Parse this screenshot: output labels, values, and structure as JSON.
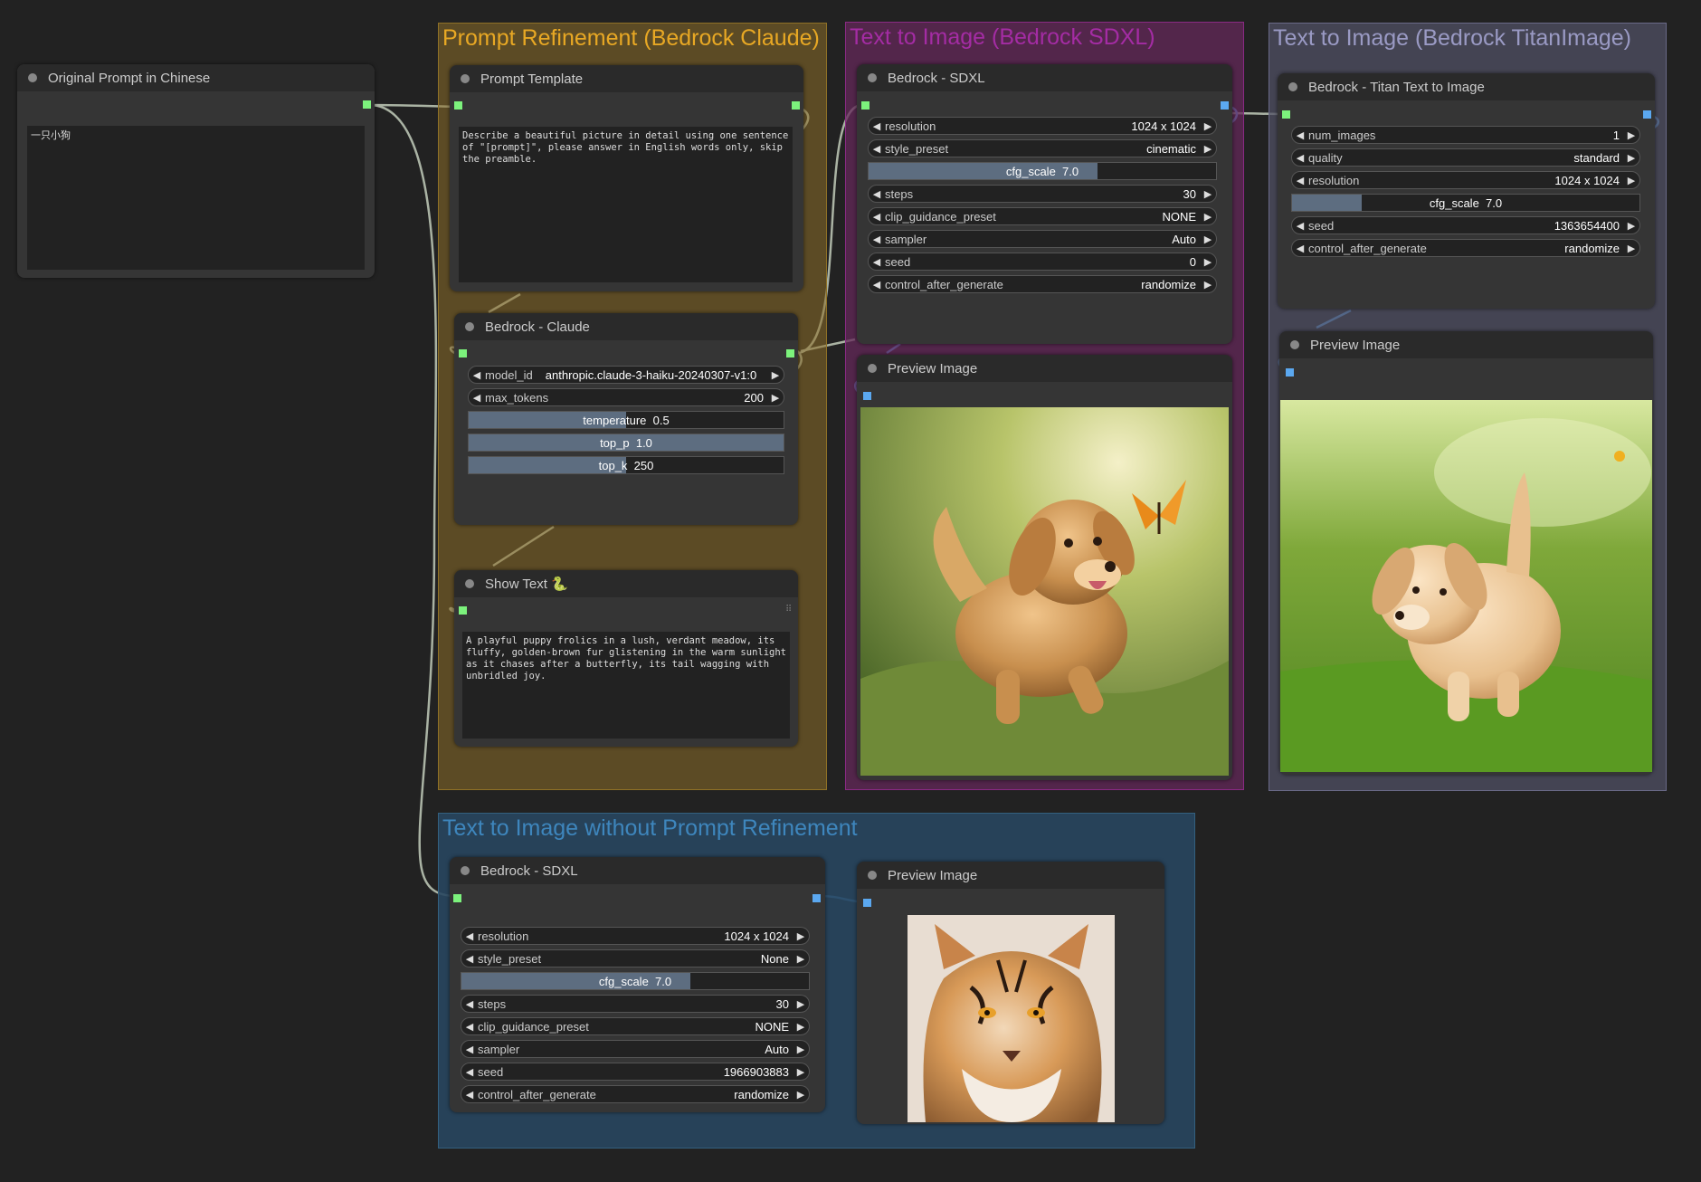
{
  "groups": {
    "claude": {
      "title": "Prompt Refinement (Bedrock Claude)"
    },
    "sdxl": {
      "title": "Text to Image (Bedrock SDXL)"
    },
    "titan": {
      "title": "Text to Image (Bedrock TitanImage)"
    },
    "noref": {
      "title": "Text to Image without Prompt Refinement"
    }
  },
  "original_prompt": {
    "title": "Original Prompt in Chinese",
    "text": "一只小狗"
  },
  "prompt_template": {
    "title": "Prompt Template",
    "text": "Describe a beautiful picture in detail using one sentence of \"[prompt]\", please answer in English words only, skip the preamble."
  },
  "claude": {
    "title": "Bedrock - Claude",
    "model_id_label": "model_id",
    "model_id": "anthropic.claude-3-haiku-20240307-v1:0",
    "max_tokens_label": "max_tokens",
    "max_tokens": "200",
    "temperature_label": "temperature",
    "temperature": "0.5",
    "temperature_fill": 0.5,
    "top_p_label": "top_p",
    "top_p": "1.0",
    "top_p_fill": 1.0,
    "top_k_label": "top_k",
    "top_k": "250",
    "top_k_fill": 0.5
  },
  "show_text": {
    "title": "Show Text 🐍",
    "text": "A playful puppy frolics in a lush, verdant meadow, its fluffy, golden-brown fur glistening in the warm sunlight as it chases after a butterfly, its tail wagging with unbridled joy."
  },
  "sdxl": {
    "title": "Bedrock - SDXL",
    "resolution_label": "resolution",
    "resolution": "1024 x 1024",
    "style_preset_label": "style_preset",
    "style_preset": "cinematic",
    "cfg_label": "cfg_scale",
    "cfg": "7.0",
    "cfg_fill": 0.66,
    "steps_label": "steps",
    "steps": "30",
    "clip_label": "clip_guidance_preset",
    "clip": "NONE",
    "sampler_label": "sampler",
    "sampler": "Auto",
    "seed_label": "seed",
    "seed": "0",
    "cag_label": "control_after_generate",
    "cag": "randomize"
  },
  "sdxl_preview": {
    "title": "Preview Image"
  },
  "titan": {
    "title": "Bedrock - Titan Text to Image",
    "num_images_label": "num_images",
    "num_images": "1",
    "quality_label": "quality",
    "quality": "standard",
    "resolution_label": "resolution",
    "resolution": "1024 x 1024",
    "cfg_label": "cfg_scale",
    "cfg": "7.0",
    "cfg_fill": 0.2,
    "seed_label": "seed",
    "seed": "1363654400",
    "cag_label": "control_after_generate",
    "cag": "randomize"
  },
  "titan_preview": {
    "title": "Preview Image"
  },
  "sdxl2": {
    "title": "Bedrock - SDXL",
    "resolution_label": "resolution",
    "resolution": "1024 x 1024",
    "style_preset_label": "style_preset",
    "style_preset": "None",
    "cfg_label": "cfg_scale",
    "cfg": "7.0",
    "cfg_fill": 0.66,
    "steps_label": "steps",
    "steps": "30",
    "clip_label": "clip_guidance_preset",
    "clip": "NONE",
    "sampler_label": "sampler",
    "sampler": "Auto",
    "seed_label": "seed",
    "seed": "1966903883",
    "cag_label": "control_after_generate",
    "cag": "randomize"
  },
  "noref_preview": {
    "title": "Preview Image"
  },
  "colors": {
    "claude_group": "#d5a021",
    "sdxl_group": "#a02aa0",
    "titan_group": "#8a8ab8",
    "noref_group": "#3a7ab0",
    "link_text": "#c6cfc0",
    "link_image": "#5ba8f0"
  }
}
